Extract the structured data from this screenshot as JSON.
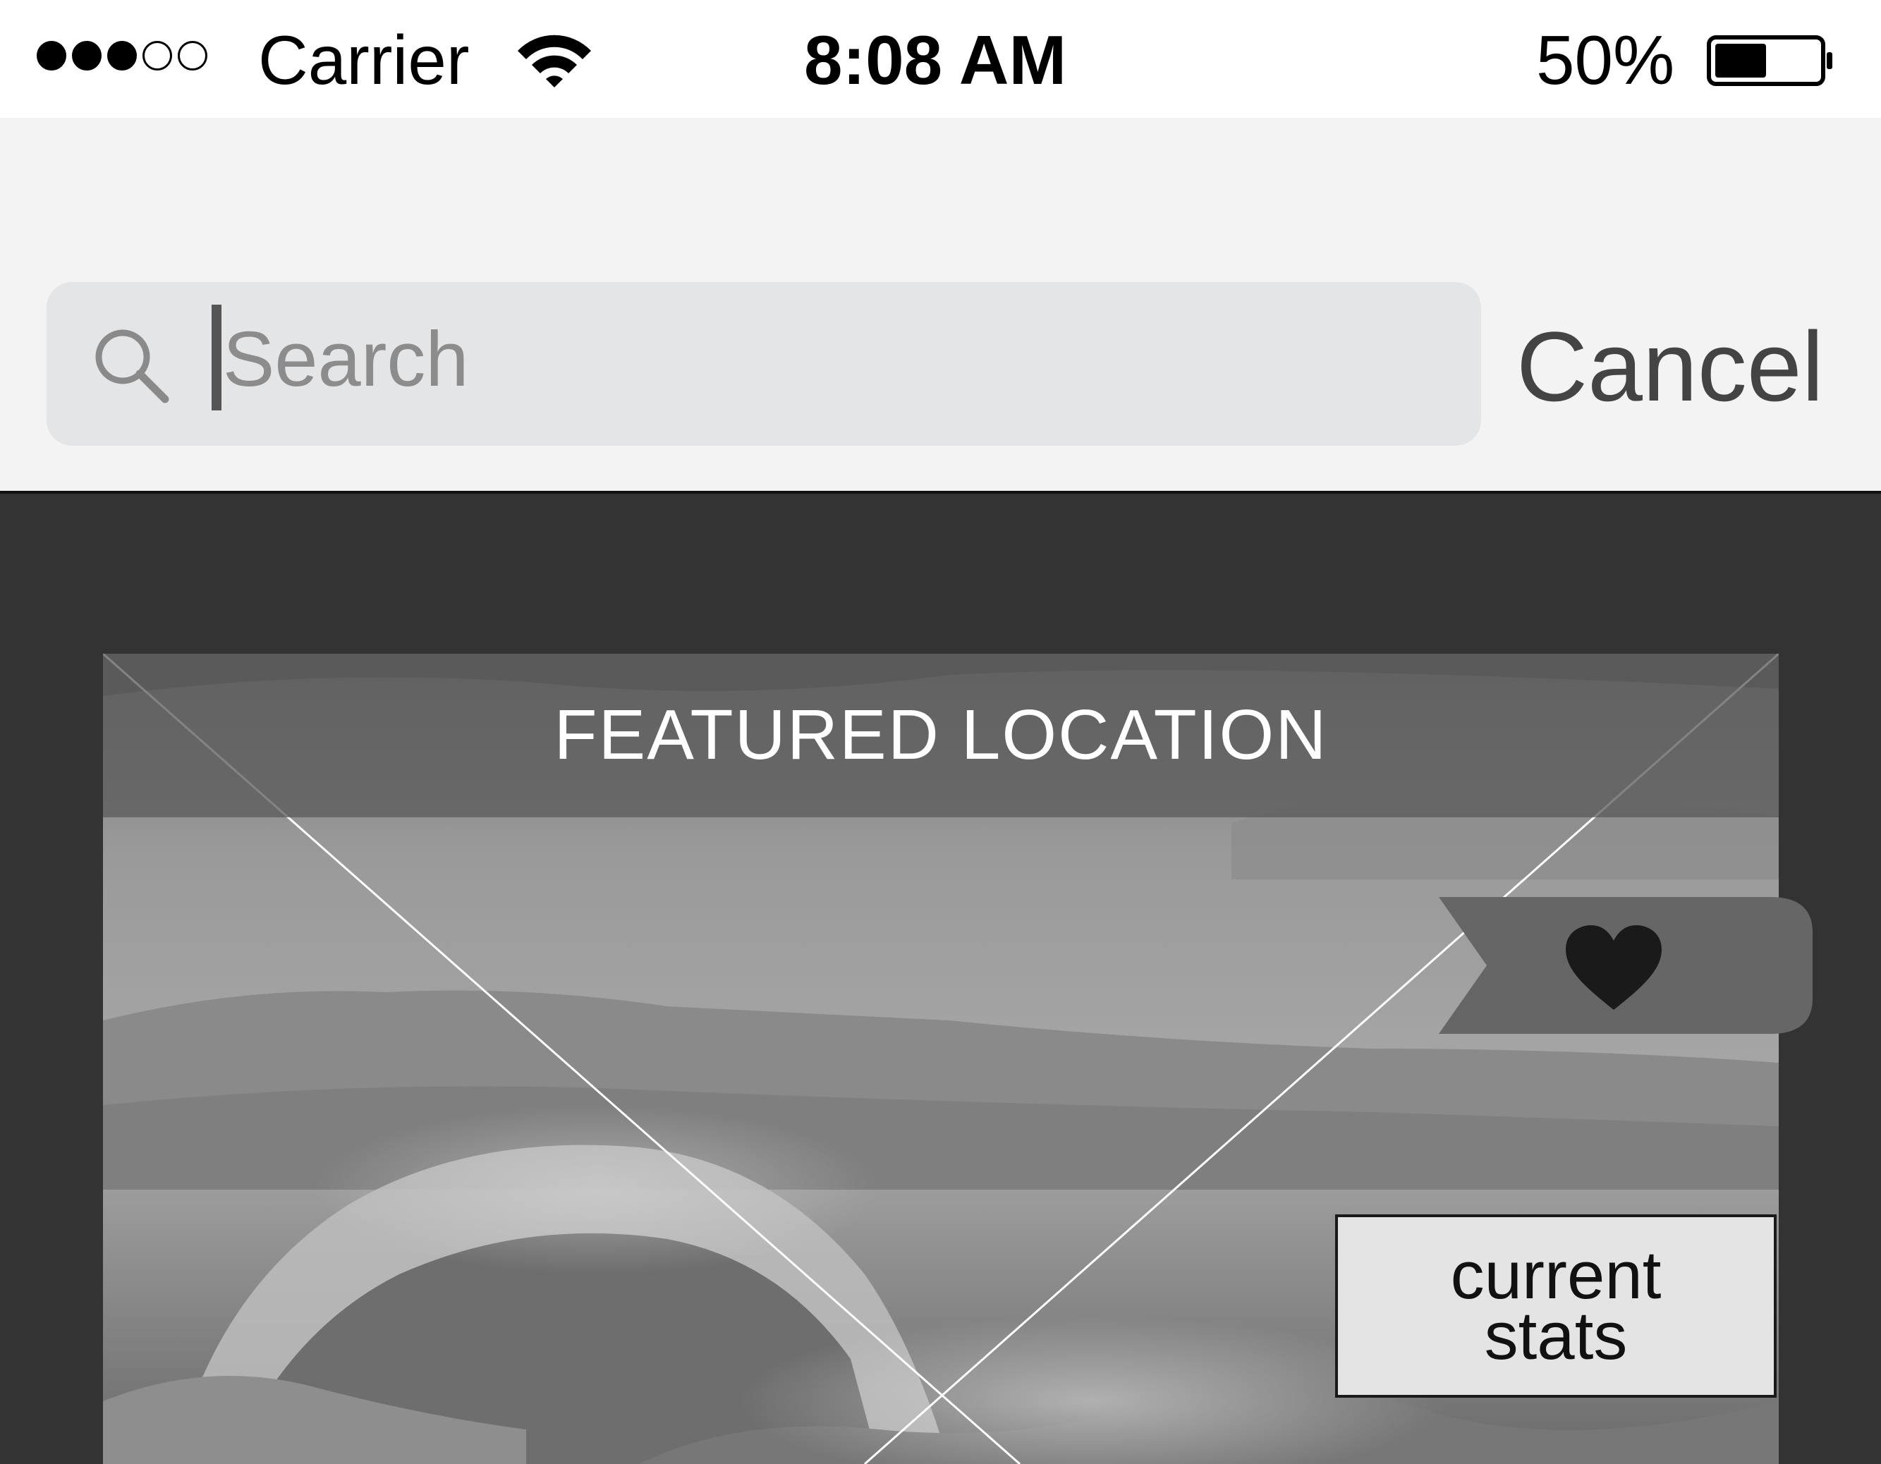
{
  "status_bar": {
    "carrier": "Carrier",
    "time": "8:08 AM",
    "battery_percent": "50%",
    "battery_level": 0.5,
    "signal_strength": 3,
    "signal_total": 5,
    "wifi_icon": "wifi-icon"
  },
  "search": {
    "placeholder": "Search",
    "cancel_label": "Cancel",
    "icon": "magnifier-icon"
  },
  "featured": {
    "title": "FEATURED LOCATION",
    "favorite_icon": "heart-icon",
    "stats_line1": "current",
    "stats_line2": "stats"
  },
  "colors": {
    "status_bar_bg": "#ffffff",
    "search_bar_bg": "#f3f3f3",
    "search_field_bg": "#e4e5e7",
    "content_bg": "#333333",
    "banner_bg": "#5a5a5a",
    "ribbon_bg": "#666666"
  }
}
